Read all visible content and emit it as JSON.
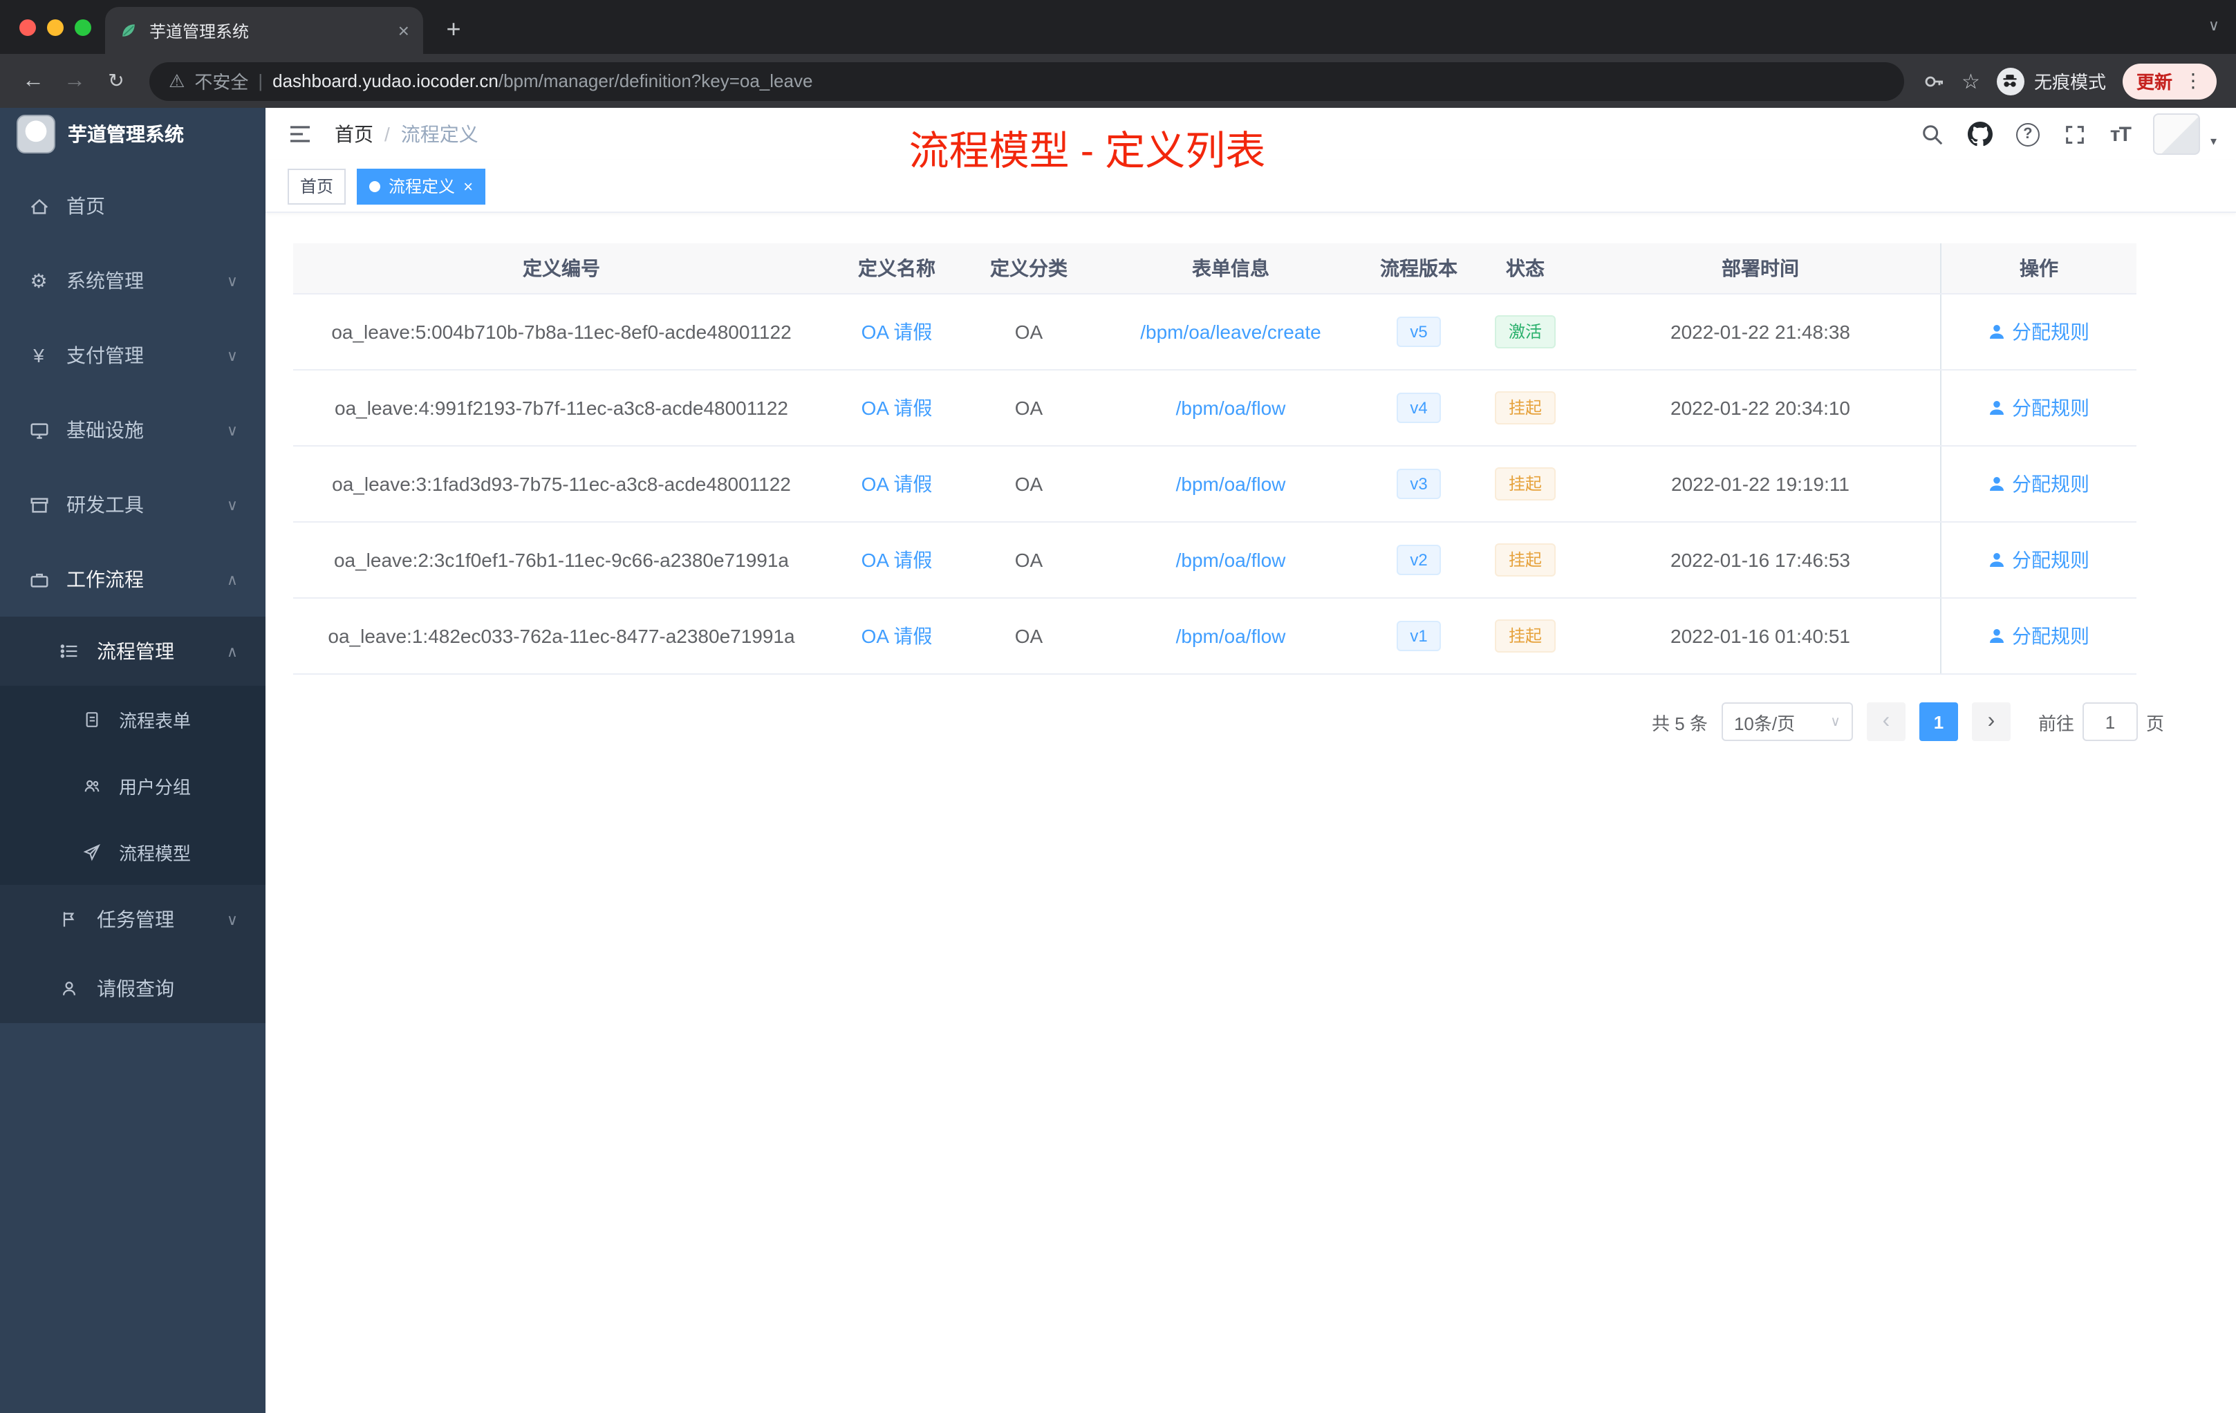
{
  "browser": {
    "tab": {
      "title": "芋道管理系统"
    },
    "security_label": "不安全",
    "url_host": "dashboard.yudao.iocoder.cn",
    "url_path": "/bpm/manager/definition?key=oa_leave",
    "incognito_label": "无痕模式",
    "update_label": "更新"
  },
  "icons": {
    "back": "←",
    "forward": "→",
    "reload": "↻",
    "plus": "+",
    "close": "×",
    "warning": "⚠",
    "star": "☆",
    "kebab": "⋮",
    "gear": "⚙",
    "yen": "¥",
    "chevron_down": "∨",
    "chevron_up": "∧",
    "caret_down": "▾",
    "prev": "‹",
    "next": "›",
    "question_mark": "?"
  },
  "sidebar": {
    "app_title": "芋道管理系统",
    "items": [
      {
        "label": "首页",
        "icon": "home-icon"
      },
      {
        "label": "系统管理",
        "icon": "gear-icon"
      },
      {
        "label": "支付管理",
        "icon": "yen-icon"
      },
      {
        "label": "基础设施",
        "icon": "monitor-icon"
      },
      {
        "label": "研发工具",
        "icon": "toolbox-icon"
      },
      {
        "label": "工作流程",
        "icon": "briefcase-icon",
        "expanded": true
      }
    ],
    "submenu": {
      "process_management": {
        "label": "流程管理",
        "icon": "list-icon",
        "expanded": true,
        "children": [
          {
            "label": "流程表单",
            "icon": "document-icon"
          },
          {
            "label": "用户分组",
            "icon": "users-icon"
          },
          {
            "label": "流程模型",
            "icon": "send-icon"
          }
        ]
      },
      "task_management": {
        "label": "任务管理",
        "icon": "flag-icon",
        "expanded": false
      },
      "leave_query": {
        "label": "请假查询",
        "icon": "user-icon"
      }
    }
  },
  "header": {
    "breadcrumb": {
      "home": "首页",
      "sep": "/",
      "current": "流程定义"
    },
    "annotation": "流程模型 - 定义列表",
    "annotation_color": "#f2270c"
  },
  "tags": [
    {
      "label": "首页",
      "active": false
    },
    {
      "label": "流程定义",
      "active": true
    }
  ],
  "table": {
    "columns": [
      "定义编号",
      "定义名称",
      "定义分类",
      "表单信息",
      "流程版本",
      "状态",
      "部署时间",
      "操作"
    ],
    "rows": [
      {
        "id": "oa_leave:5:004b710b-7b8a-11ec-8ef0-acde48001122",
        "name": "OA 请假",
        "category": "OA",
        "form": "/bpm/oa/leave/create",
        "version": "v5",
        "status": "激活",
        "deployed_at": "2022-01-22 21:48:38",
        "action": "分配规则"
      },
      {
        "id": "oa_leave:4:991f2193-7b7f-11ec-a3c8-acde48001122",
        "name": "OA 请假",
        "category": "OA",
        "form": "/bpm/oa/flow",
        "version": "v4",
        "status": "挂起",
        "deployed_at": "2022-01-22 20:34:10",
        "action": "分配规则"
      },
      {
        "id": "oa_leave:3:1fad3d93-7b75-11ec-a3c8-acde48001122",
        "name": "OA 请假",
        "category": "OA",
        "form": "/bpm/oa/flow",
        "version": "v3",
        "status": "挂起",
        "deployed_at": "2022-01-22 19:19:11",
        "action": "分配规则"
      },
      {
        "id": "oa_leave:2:3c1f0ef1-76b1-11ec-9c66-a2380e71991a",
        "name": "OA 请假",
        "category": "OA",
        "form": "/bpm/oa/flow",
        "version": "v2",
        "status": "挂起",
        "deployed_at": "2022-01-16 17:46:53",
        "action": "分配规则"
      },
      {
        "id": "oa_leave:1:482ec033-762a-11ec-8477-a2380e71991a",
        "name": "OA 请假",
        "category": "OA",
        "form": "/bpm/oa/flow",
        "version": "v1",
        "status": "挂起",
        "deployed_at": "2022-01-16 01:40:51",
        "action": "分配规则"
      }
    ]
  },
  "pagination": {
    "total": "共 5 条",
    "page_size": "10条/页",
    "current_page": "1",
    "goto_label": "前往",
    "goto_value": "1",
    "goto_suffix": "页"
  },
  "colors": {
    "accent_blue": "#409eff",
    "status_active_green": "#29b06b",
    "status_suspended_orange": "#e6a23c",
    "sidebar_bg": "#304156",
    "browser_dark": "#202124"
  }
}
